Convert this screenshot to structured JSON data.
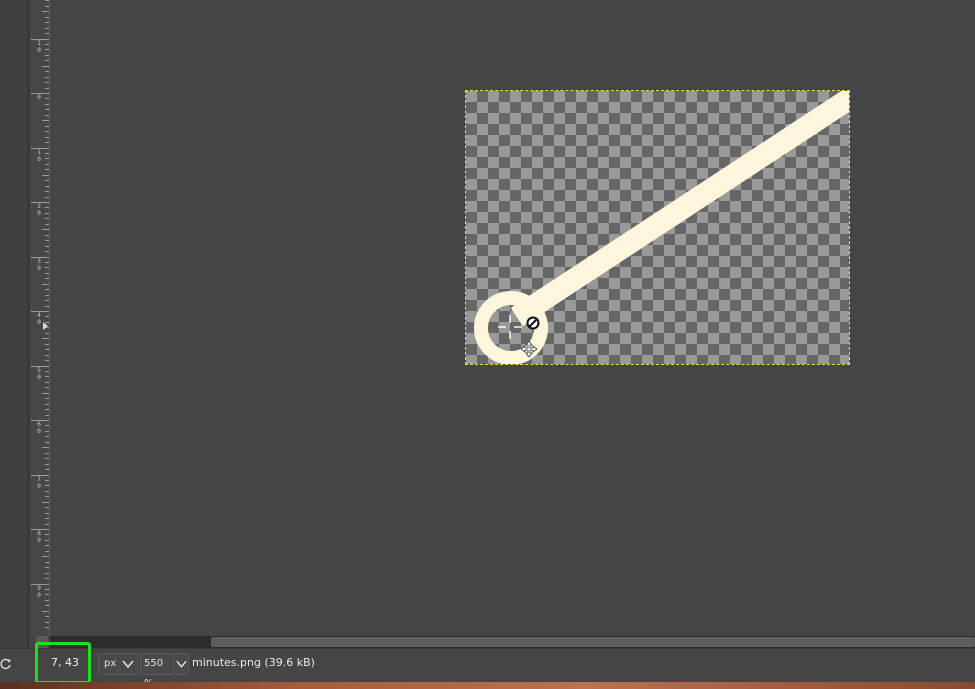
{
  "ruler": {
    "labels": [
      {
        "digits": [
          "1",
          "0"
        ]
      },
      {
        "digits": [
          "0"
        ]
      },
      {
        "digits": [
          "1",
          "0"
        ]
      },
      {
        "digits": [
          "2",
          "0"
        ]
      },
      {
        "digits": [
          "3",
          "0"
        ]
      },
      {
        "digits": [
          "4",
          "0"
        ]
      },
      {
        "digits": [
          "5",
          "0"
        ]
      },
      {
        "digits": [
          "6",
          "0"
        ]
      },
      {
        "digits": [
          "7",
          "0"
        ]
      },
      {
        "digits": [
          "8",
          "0"
        ]
      },
      {
        "digits": [
          "9",
          "0"
        ]
      }
    ]
  },
  "statusbar": {
    "coordinates": "7, 43",
    "unit": "px",
    "zoom": "550 %",
    "file_info": "minutes.png (39.6 kB)"
  },
  "colors": {
    "highlight": "#1fe01f",
    "selection": "#e8e820",
    "stroke": "#fdf5dc"
  },
  "icons": {
    "refresh": "refresh-icon",
    "unit_dropdown": "chevron-down-icon",
    "zoom_dropdown": "chevron-down-icon",
    "cursor_forbidden": "forbidden-icon",
    "cursor_move": "move-icon",
    "cursor_crosshair": "crosshair-icon"
  }
}
